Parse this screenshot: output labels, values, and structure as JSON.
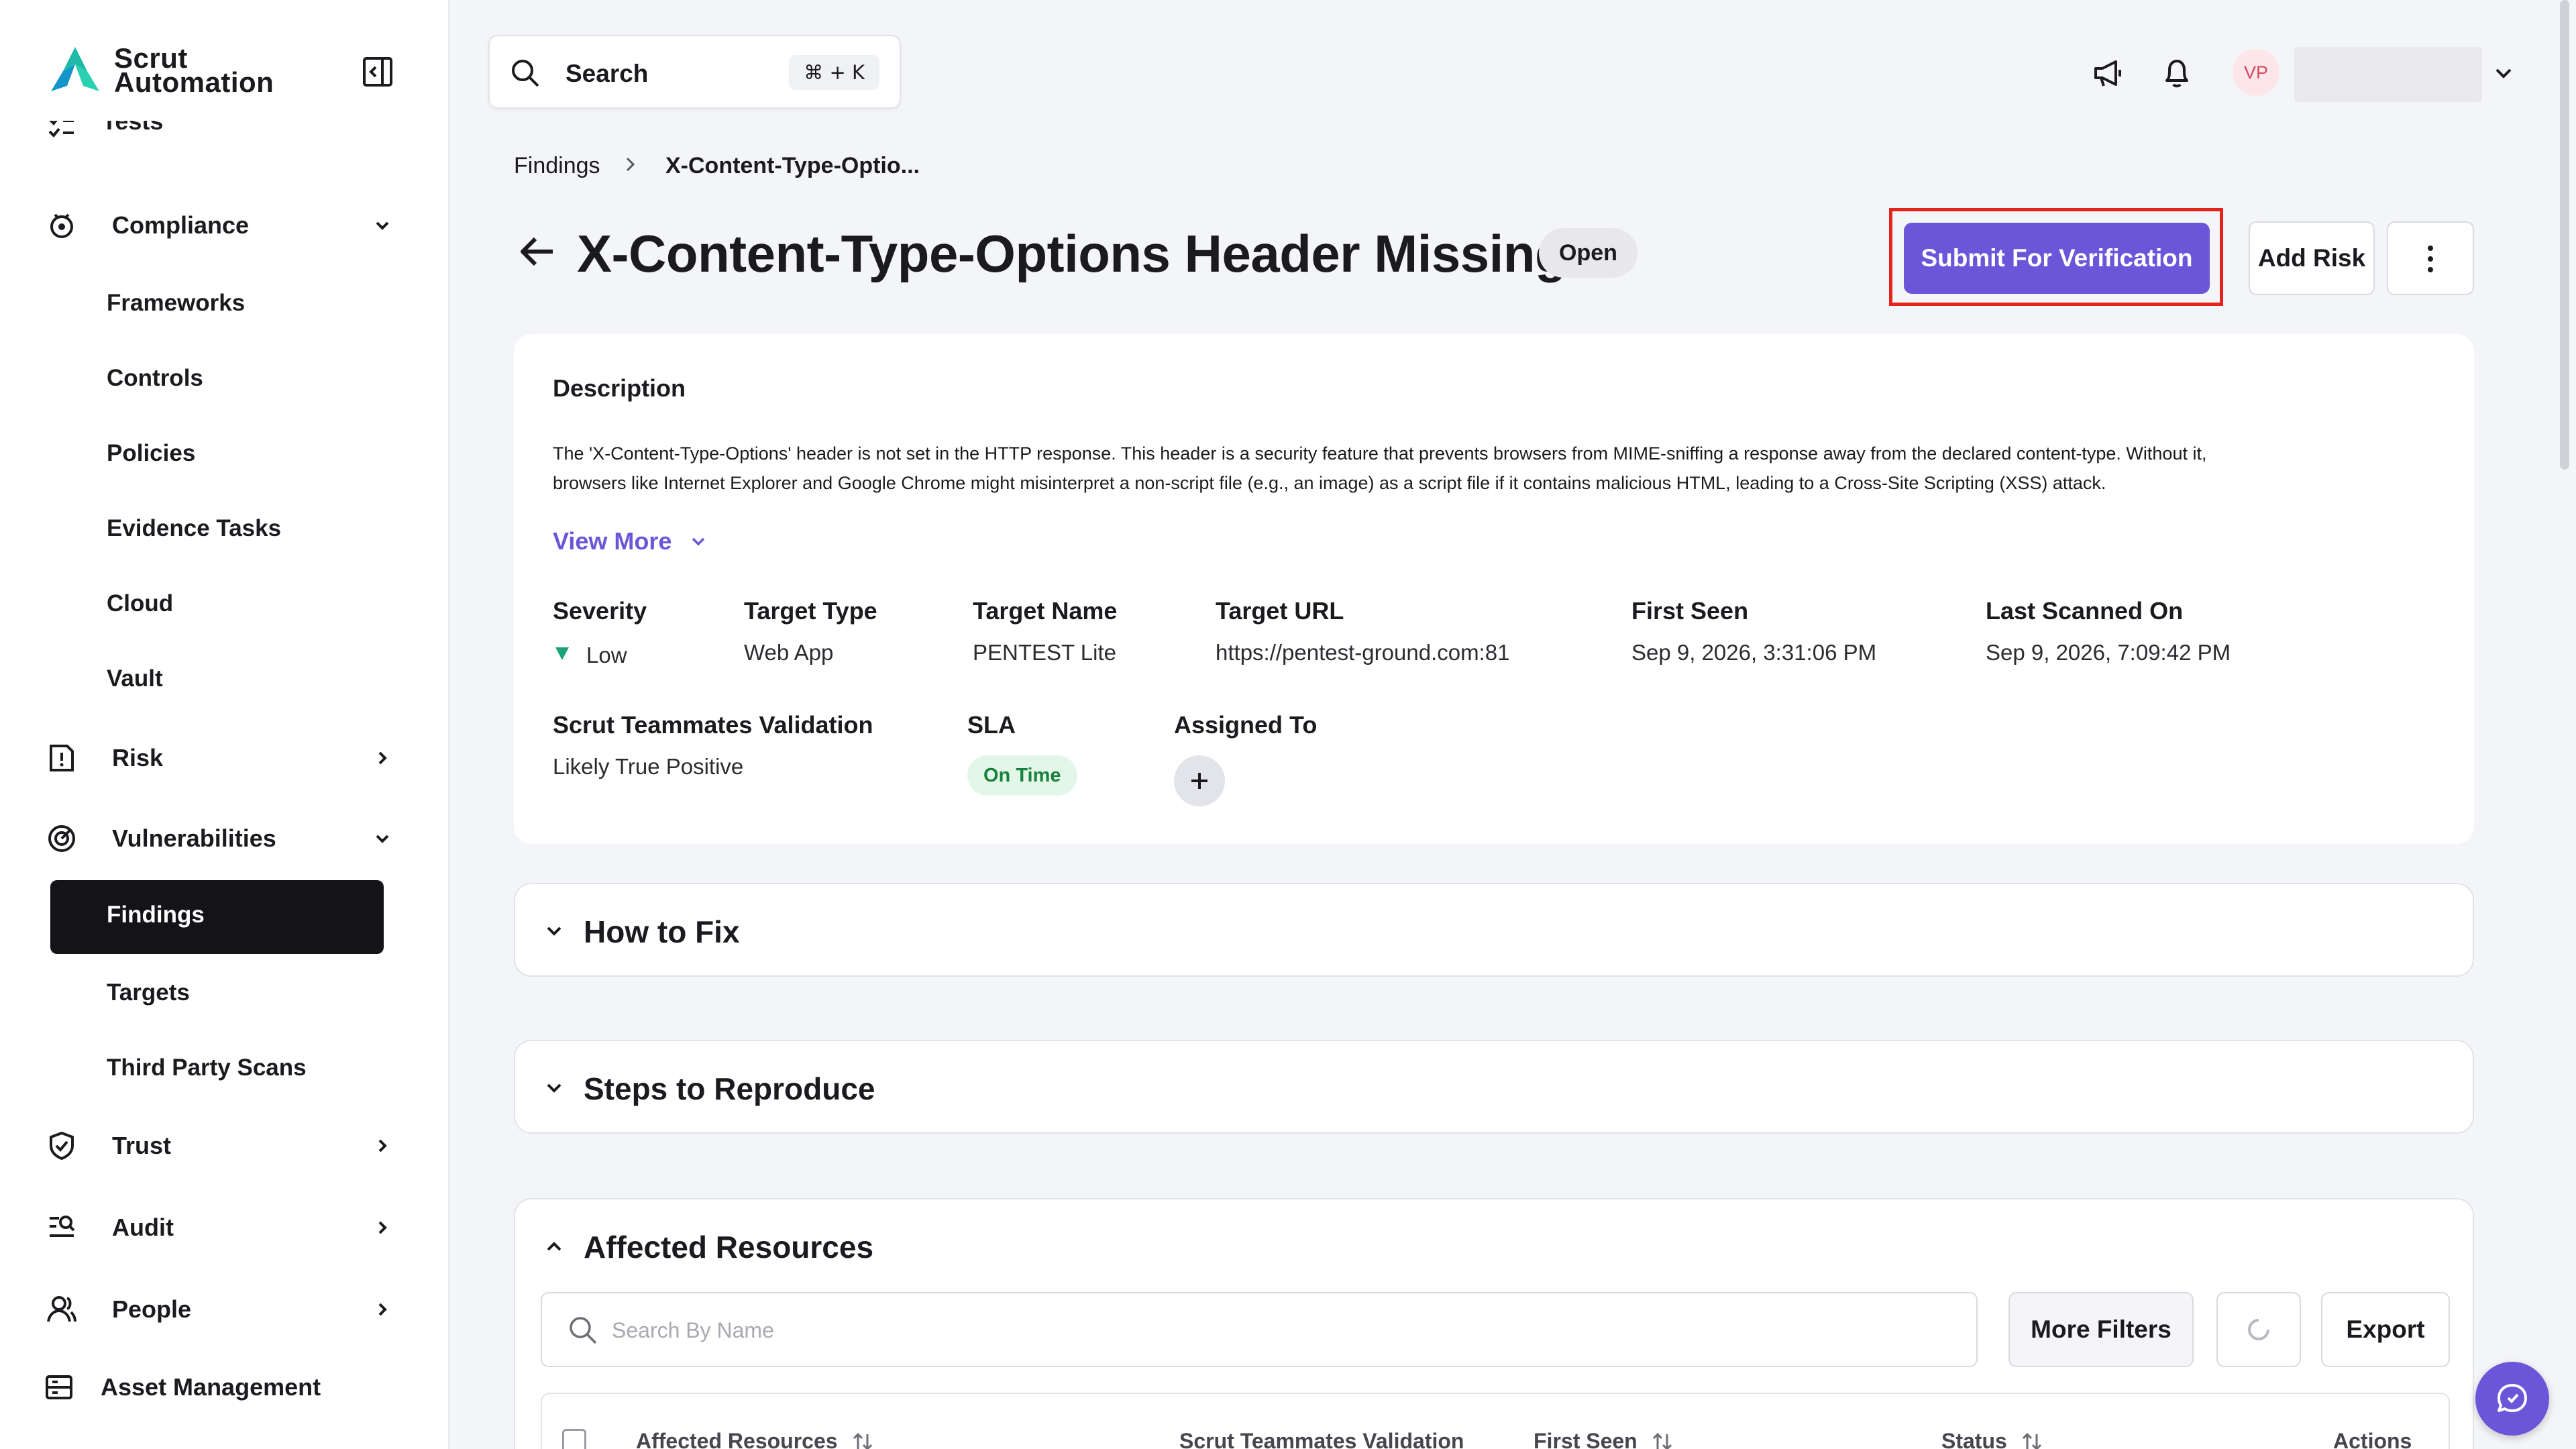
{
  "app": {
    "name_line1": "Scrut",
    "name_line2": "Automation"
  },
  "sidebar": {
    "items": [
      {
        "label": "Tests"
      },
      {
        "label": "Compliance"
      },
      {
        "label": "Frameworks"
      },
      {
        "label": "Controls"
      },
      {
        "label": "Policies"
      },
      {
        "label": "Evidence Tasks"
      },
      {
        "label": "Cloud"
      },
      {
        "label": "Vault"
      },
      {
        "label": "Risk"
      },
      {
        "label": "Vulnerabilities"
      },
      {
        "label": "Findings"
      },
      {
        "label": "Targets"
      },
      {
        "label": "Third Party Scans"
      },
      {
        "label": "Trust"
      },
      {
        "label": "Audit"
      },
      {
        "label": "People"
      },
      {
        "label": "Asset Management"
      }
    ]
  },
  "topbar": {
    "search_label": "Search",
    "search_shortcut": "⌘ + K",
    "avatar_initials": "VP"
  },
  "breadcrumb": {
    "parent": "Findings",
    "current": "X-Content-Type-Optio..."
  },
  "finding": {
    "title": "X-Content-Type-Options Header Missing",
    "status": "Open",
    "actions": {
      "submit": "Submit For Verification",
      "add_risk": "Add Risk"
    },
    "description_heading": "Description",
    "description_line1": "The 'X-Content-Type-Options' header is not set in the HTTP response. This header is a security feature that prevents browsers from MIME-sniffing a response away from the declared content-type. Without it,",
    "description_line2": "browsers like Internet Explorer and Google Chrome might misinterpret a non-script file (e.g., an image) as a script file if it contains malicious HTML, leading to a Cross-Site Scripting (XSS) attack.",
    "view_more": "View More",
    "fields": {
      "severity_label": "Severity",
      "severity_value": "Low",
      "target_type_label": "Target Type",
      "target_type_value": "Web App",
      "target_name_label": "Target Name",
      "target_name_value": "PENTEST Lite",
      "target_url_label": "Target URL",
      "target_url_value": "https://pentest-ground.com:81",
      "first_seen_label": "First Seen",
      "first_seen_value": "Sep 9, 2026, 3:31:06 PM",
      "last_scanned_label": "Last Scanned On",
      "last_scanned_value": "Sep 9, 2026, 7:09:42 PM",
      "validation_label": "Scrut Teammates Validation",
      "validation_value": "Likely True Positive",
      "sla_label": "SLA",
      "sla_value": "On Time",
      "assigned_label": "Assigned To"
    },
    "sections": {
      "how_to_fix": "How to Fix",
      "steps": "Steps to Reproduce",
      "affected": "Affected Resources"
    }
  },
  "affected": {
    "search_placeholder": "Search By Name",
    "more_filters": "More Filters",
    "export": "Export",
    "columns": [
      "Affected Resources",
      "Scrut Teammates Validation",
      "First Seen",
      "Status",
      "Actions"
    ]
  },
  "colors": {
    "accent": "#6b56d9",
    "highlight": "#e3241b",
    "sla_green": "#17803d",
    "severity_low": "#1aa37a"
  }
}
